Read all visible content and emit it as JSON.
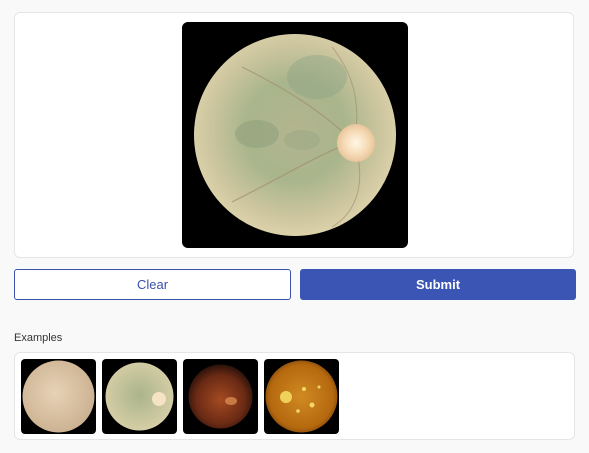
{
  "buttons": {
    "clear_label": "Clear",
    "submit_label": "Submit"
  },
  "examples": {
    "label": "Examples",
    "items": [
      {
        "icon": "fundus-image-pale"
      },
      {
        "icon": "fundus-image-green"
      },
      {
        "icon": "fundus-image-dark-red"
      },
      {
        "icon": "fundus-image-orange-lesions"
      }
    ]
  },
  "colors": {
    "accent": "#3a55b4",
    "panel_border": "#e5e5e5",
    "background": "#f9f9f9"
  }
}
